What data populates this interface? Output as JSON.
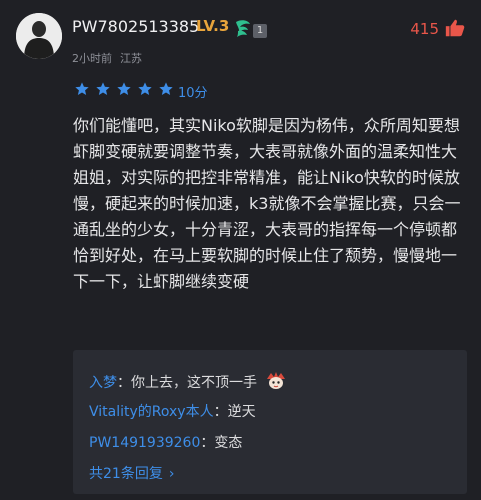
{
  "user": {
    "name": "PW7802513385",
    "level": "LV.3",
    "badge_count": "1",
    "time": "2小时前",
    "location": "江苏"
  },
  "likes": {
    "count": "415"
  },
  "rating": {
    "stars": 5,
    "score": "10分"
  },
  "comment": {
    "text": "你们能懂吧，其实Niko软脚是因为杨伟，众所周知要想虾脚变硬就要调整节奏，大表哥就像外面的温柔知性大姐姐，对实际的把控非常精准，能让Niko快软的时候放慢，硬起来的时候加速，k3就像不会掌握比赛，只会一通乱坐的少女，十分青涩，大表哥的指挥每一个停顿都恰到好处，在马上要软脚的时候止住了颓势，慢慢地一下一下，让虾脚继续变硬"
  },
  "replies": [
    {
      "name": "入梦",
      "text": "你上去，这不顶一手"
    },
    {
      "name": "Vitality的Roxy本人",
      "text": "逆天"
    },
    {
      "name": "PW1491939260",
      "text": "变态"
    }
  ],
  "more_replies": {
    "label": "共21条回复"
  },
  "colors": {
    "accent": "#3e8ee8",
    "like": "#e9564a",
    "level": "#e9a53c",
    "background": "#1f2025"
  }
}
